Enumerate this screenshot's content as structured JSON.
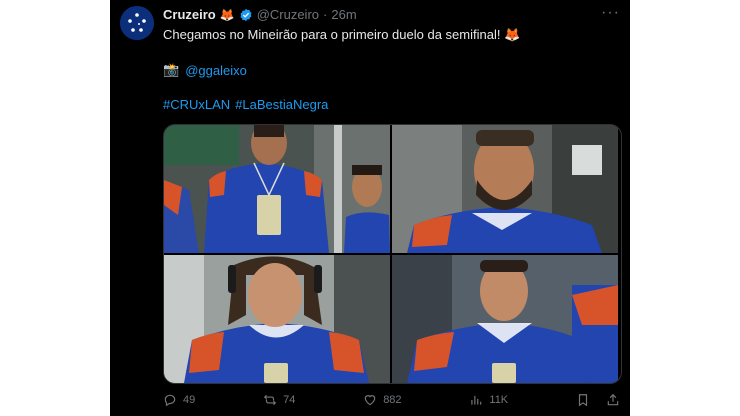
{
  "tweet": {
    "display_name": "Cruzeiro",
    "name_emoji": "🦊",
    "handle": "@Cruzeiro",
    "separator": "·",
    "time": "26m",
    "more": "···",
    "text": "Chegamos no Mineirão para o primeiro duelo da semifinal! 🦊",
    "camera_emoji": "📸",
    "mention": "@ggaleixo",
    "hashtags": [
      "#CRUxLAN",
      "#LaBestiaNegra"
    ],
    "colors": {
      "accent": "#1d9bf0",
      "background": "#000000",
      "text": "#e7e9ea",
      "muted": "#71767b",
      "club_blue": "#1f3fa3",
      "club_orange": "#e0552a"
    },
    "photos": [
      {
        "description_icon": "player-photo-1"
      },
      {
        "description_icon": "player-photo-2"
      },
      {
        "description_icon": "player-photo-3"
      },
      {
        "description_icon": "player-photo-4"
      }
    ],
    "actions": {
      "replies": "49",
      "retweets": "74",
      "likes": "882",
      "views": "11K"
    }
  }
}
